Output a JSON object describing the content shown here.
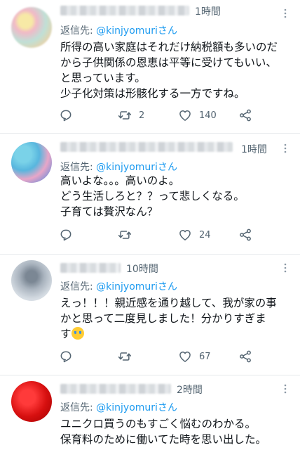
{
  "reply_prefix": "返信先: ",
  "reply_handle": "@kinjyomuri",
  "reply_suffix": "さん",
  "more_label": "⋮",
  "tweets": [
    {
      "time": "1時間",
      "lines": [
        "所得の高い家庭はそれだけ納税額も多いのだ",
        "から子供関係の恩恵は平等に受けてもいい、",
        "と思っています。",
        "少子化対策は形骸化する一方ですね。"
      ],
      "reply_count": "",
      "retweet_count": "2",
      "like_count": "140"
    },
    {
      "time": "1時間",
      "lines": [
        "高いよな。。。高いのよ。",
        "どう生活しろと？？って悲しくなる。",
        "子育ては贅沢なん？"
      ],
      "reply_count": "",
      "retweet_count": "",
      "like_count": "24"
    },
    {
      "time": "10時間",
      "lines": [
        "えっ！！！親近感を通り越して、我が家の事",
        "かと思って二度見しました！分かりすぎま",
        "す"
      ],
      "emoji": "loudly-crying-face",
      "reply_count": "",
      "retweet_count": "",
      "like_count": "67"
    },
    {
      "time": "2時間",
      "lines": [
        "ユニクロ買うのもすごく悩むのわかる。",
        "保育料のために働いてた時を思い出した。"
      ]
    }
  ],
  "icons": {
    "reply": "reply-icon",
    "retweet": "retweet-icon",
    "like": "heart-icon",
    "share": "share-icon",
    "more": "more-icon"
  },
  "colors": {
    "handle": "#1d9bf0",
    "muted": "#536471",
    "text": "#0f1419"
  }
}
